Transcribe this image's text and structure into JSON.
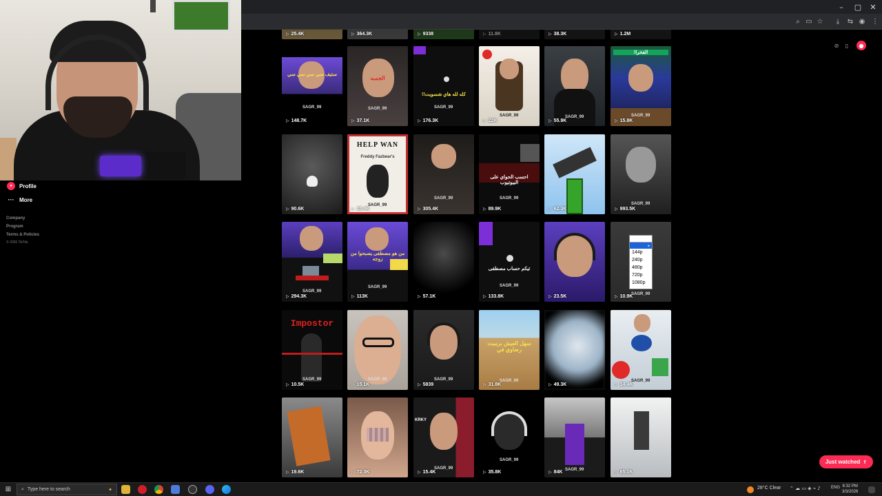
{
  "colors": {
    "accent": "#fe2c55",
    "background": "#000000",
    "highlight": "#1d64d8"
  },
  "window": {
    "minimize": "–",
    "maximize": "▢",
    "close": "✕"
  },
  "browser_icons": [
    "zoom-icon",
    "install-icon",
    "star-icon",
    "download-icon",
    "translate-icon",
    "profile-icon",
    "menu-icon"
  ],
  "sidebar": {
    "items": [
      {
        "label": "Profile",
        "icon": "profile-icon"
      },
      {
        "label": "More",
        "icon": "more-icon"
      }
    ],
    "footer": [
      "Company",
      "Program",
      "Terms & Policies"
    ],
    "copyright": "© 2026 TikTok"
  },
  "videos": [
    {
      "views": "25.4K"
    },
    {
      "views": "364.3K"
    },
    {
      "views": "9338"
    },
    {
      "views": "11.8K"
    },
    {
      "views": "38.3K"
    },
    {
      "views": "1.2M"
    },
    {
      "views": "148.7K",
      "tag": "SAGR_99",
      "caption": "ستيف سي سي سي سي"
    },
    {
      "views": "37.1K",
      "tag": "SAGR_99",
      "caption": "الجمبه"
    },
    {
      "views": "176.3K",
      "tag": "SAGR_99",
      "caption": "كله لله هاي شسويت!!"
    },
    {
      "views": "22K",
      "tag": "SAGR_99"
    },
    {
      "views": "55.9K",
      "tag": "SAGR_99"
    },
    {
      "views": "15.8K",
      "tag": "SAGR_99",
      "caption": "الفخرا!"
    },
    {
      "views": "90.6K",
      "tag": "SAGR_99"
    },
    {
      "views": "15.4K",
      "tag": "SAGR_99",
      "caption": "HELP WAN",
      "subcaption": "Freddy Fazbear's"
    },
    {
      "views": "305.4K",
      "tag": "SAGR_99"
    },
    {
      "views": "89.9K",
      "tag": "SAGR_99",
      "caption": "احسب الحواي على البيوتيوب"
    },
    {
      "views": "62.3K"
    },
    {
      "views": "993.5K",
      "tag": "SAGR_99"
    },
    {
      "views": "294.3K",
      "tag": "SAGR_99"
    },
    {
      "views": "113K",
      "tag": "SAGR_99",
      "caption": "من هو مصطفى يصبحوا من زوجه"
    },
    {
      "views": "57.1K"
    },
    {
      "views": "133.8K",
      "tag": "SAGR_99",
      "caption": "تيكم حساب مصطفى"
    },
    {
      "views": "23.5K"
    },
    {
      "views": "10.9K",
      "tag": "SAGR_99"
    },
    {
      "views": "10.5K",
      "tag": "SAGR_99",
      "caption": "Impostor"
    },
    {
      "views": "15.1K",
      "tag": "SAGR_99"
    },
    {
      "views": "5839",
      "tag": "SAGR_99"
    },
    {
      "views": "31.8K",
      "tag": "SAGR_99",
      "caption": "سهل العيش برميت رضاوي في"
    },
    {
      "views": "49.3K"
    },
    {
      "views": "14.4K",
      "tag": "SAGR_99"
    },
    {
      "views": "19.6K"
    },
    {
      "views": "72.3K"
    },
    {
      "views": "15.4K",
      "tag": "SAGR_99",
      "caption": "KRKY"
    },
    {
      "views": "35.8K",
      "tag": "SAGR_99"
    },
    {
      "views": "84K",
      "tag": "SAGR_99"
    },
    {
      "views": "65.1K"
    }
  ],
  "resolution": {
    "options": [
      "144p",
      "240p",
      "480p",
      "720p",
      "1080p"
    ]
  },
  "right_icons": [
    "clip-icon",
    "phone-icon",
    "tiktok-icon"
  ],
  "just_watched": "Just watched",
  "taskbar": {
    "search_placeholder": "Type here to search",
    "weather": "28°C  Clear",
    "lang": "ENG",
    "time": "8:32 PM",
    "date": "3/3/2026"
  }
}
